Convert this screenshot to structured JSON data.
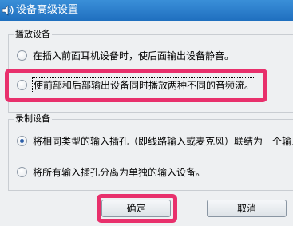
{
  "window": {
    "title": "设备高级设置",
    "icon": "speaker-icon"
  },
  "playback": {
    "group_label": "播放设备",
    "options": [
      {
        "label": "在插入前面耳机设备时，使后面输出设备静音。",
        "checked": false
      },
      {
        "label": "使前部和后部输出设备同时播放两种不同的音频流。",
        "checked": false,
        "focused": true
      }
    ]
  },
  "recording": {
    "group_label": "录制设备",
    "options": [
      {
        "label": "将相同类型的输入插孔（即线路输入或麦克风）联结为一个输入",
        "checked": true
      },
      {
        "label": "将所有输入插孔分离为单独的输入设备。",
        "checked": false
      }
    ]
  },
  "buttons": {
    "ok_label": "确定",
    "cancel_label": "取消"
  },
  "colors": {
    "titlebar": "#1f6fbf",
    "highlight": "#e8306c",
    "background": "#eef0f2"
  }
}
